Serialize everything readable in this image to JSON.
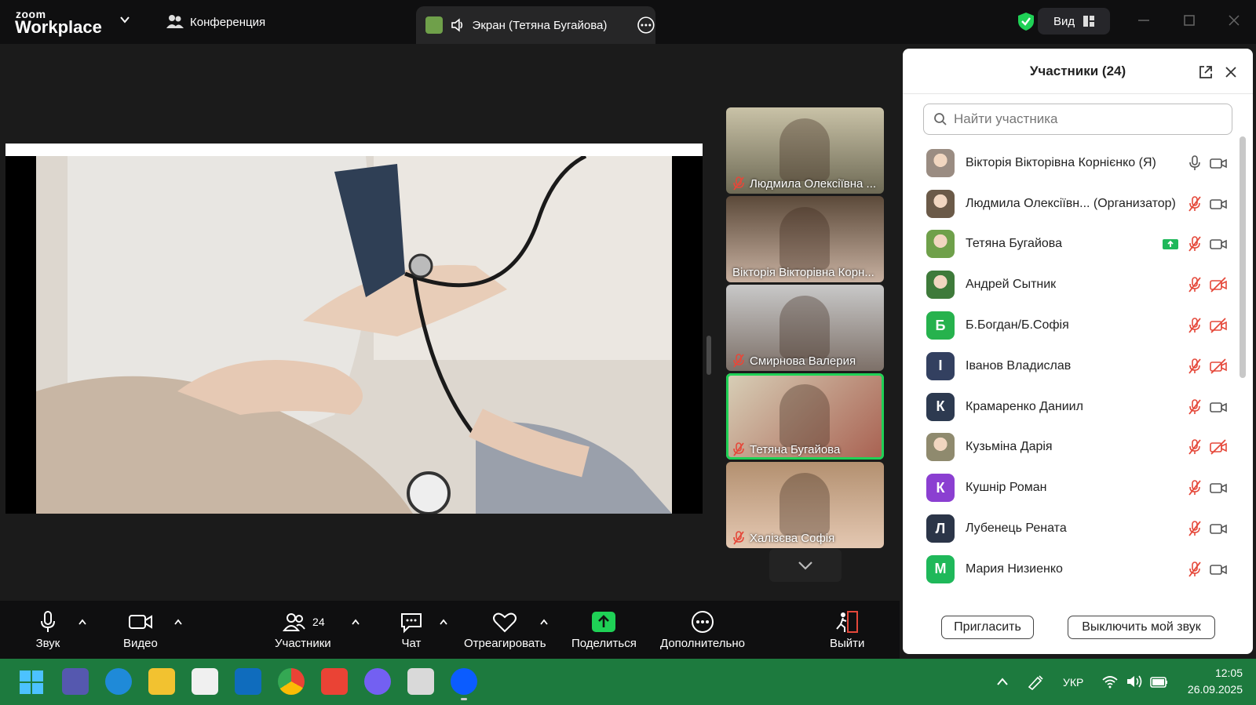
{
  "app": {
    "logo_top": "zoom",
    "logo_bottom": "Workplace",
    "meeting_label": "Конференция",
    "share_tab_label": "Экран (Тетяна Бугайова)",
    "view_label": "Вид"
  },
  "colors": {
    "accent_green": "#1fd156",
    "brand_blue": "#0b5cff",
    "muted_red": "#e5483a"
  },
  "video_tiles": [
    {
      "name": "Людмила Олексіївна ...",
      "muted": true,
      "active": false
    },
    {
      "name": "Вікторія Вікторівна Корн...",
      "muted": false,
      "active": false
    },
    {
      "name": "Смирнова Валерия",
      "muted": true,
      "active": false
    },
    {
      "name": "Тетяна Бугайова",
      "muted": true,
      "active": true
    },
    {
      "name": "Халізєва Софія",
      "muted": true,
      "active": false
    }
  ],
  "toolbar": {
    "audio": "Звук",
    "video": "Видео",
    "participants": "Участники",
    "participants_count": "24",
    "chat": "Чат",
    "react": "Отреагировать",
    "share": "Поделиться",
    "more": "Дополнительно",
    "leave": "Выйти"
  },
  "panel": {
    "title": "Участники (24)",
    "search_placeholder": "Найти участника",
    "participants": [
      {
        "name": "Вікторія Вікторівна Корнієнко (Я)",
        "avatar": "photo",
        "avatar_color": "#9a8c82",
        "initial": "",
        "mic": "on",
        "video": "on",
        "sharing": false
      },
      {
        "name": "Людмила Олексіївн... (Организатор)",
        "avatar": "photo",
        "avatar_color": "#6b5a48",
        "initial": "",
        "mic": "off",
        "video": "on",
        "sharing": false
      },
      {
        "name": "Тетяна Бугайова",
        "avatar": "photo",
        "avatar_color": "#6fa04a",
        "initial": "",
        "mic": "off",
        "video": "on",
        "sharing": true
      },
      {
        "name": "Андрей Сытник",
        "avatar": "photo",
        "avatar_color": "#3e7a3a",
        "initial": "",
        "mic": "off",
        "video": "off",
        "sharing": false
      },
      {
        "name": "Б.Богдан/Б.Софія",
        "avatar": "initial",
        "avatar_color": "#26b24d",
        "initial": "Б",
        "mic": "off",
        "video": "off",
        "sharing": false
      },
      {
        "name": "Іванов Владислав",
        "avatar": "initial",
        "avatar_color": "#334060",
        "initial": "І",
        "mic": "off",
        "video": "off",
        "sharing": false
      },
      {
        "name": "Крамаренко Даниил",
        "avatar": "initial",
        "avatar_color": "#2d3a50",
        "initial": "К",
        "mic": "off",
        "video": "on",
        "sharing": false
      },
      {
        "name": "Кузьміна Дарія",
        "avatar": "photo",
        "avatar_color": "#8f8a6e",
        "initial": "",
        "mic": "off",
        "video": "off",
        "sharing": false
      },
      {
        "name": "Кушнір Роман",
        "avatar": "initial",
        "avatar_color": "#8b3fd1",
        "initial": "К",
        "mic": "off",
        "video": "on",
        "sharing": false
      },
      {
        "name": "Лубенець Рената",
        "avatar": "initial",
        "avatar_color": "#2b3548",
        "initial": "Л",
        "mic": "off",
        "video": "on",
        "sharing": false
      },
      {
        "name": "Мария Низиенко",
        "avatar": "initial",
        "avatar_color": "#1fb85a",
        "initial": "М",
        "mic": "off",
        "video": "on",
        "sharing": false
      }
    ],
    "invite_label": "Пригласить",
    "mute_me_label": "Выключить мой звук"
  },
  "taskbar": {
    "language": "УКР",
    "time": "12:05",
    "date": "26.09.2025"
  }
}
